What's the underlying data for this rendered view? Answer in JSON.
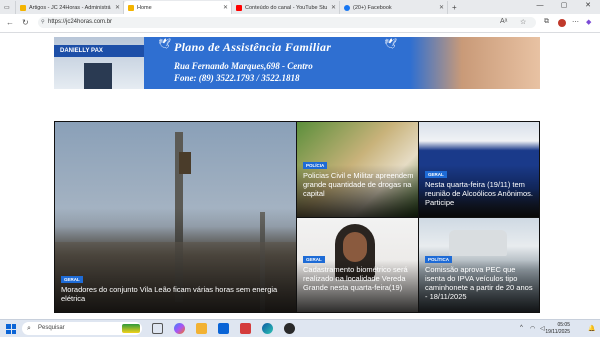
{
  "browser": {
    "tabs": [
      {
        "label": "Artigos - JC 24Horas - Administrá",
        "favicon_color": "#f4b400"
      },
      {
        "label": "Home",
        "favicon_color": "#f4b400",
        "active": true
      },
      {
        "label": "Conteúdo do canal - YouTube Stu",
        "favicon_color": "#ff0000"
      },
      {
        "label": "(20+) Facebook",
        "favicon_color": "#1877f2"
      }
    ],
    "new_tab": "+",
    "url": "https://jc24horas.com.br",
    "window_controls": {
      "minimize": "—",
      "maximize": "▢",
      "close": "✕"
    }
  },
  "banner": {
    "store_sign": "DANIELLY PAX",
    "title": "Plano de Assistência Familiar",
    "address": "Rua Fernando Marques,698 - Centro",
    "phone": "Fone: (89) 3522.1793 / 3522.1818"
  },
  "news": [
    {
      "category": "GERAL",
      "headline": "Moradores do conjunto Vila Leão ficam várias horas sem energia elétrica"
    },
    {
      "category": "POLÍCIA",
      "headline": "Policias Civil e Militar apreendem grande quantidade de drogas na capital"
    },
    {
      "category": "GERAL",
      "headline": "Nesta quarta-feira (19/11) tem reunião de Alcoólicos Anônimos. Participe"
    },
    {
      "category": "GERAL",
      "headline": "Cadastramento biométrico será realizado na localidade Vereda Grande nesta quarta-feira(19)"
    },
    {
      "category": "POLÍTICA",
      "headline": "Comissão aprova PEC que isenta do IPVA veículos tipo caminhonete a partir de 20 anos - 18/11/2025"
    }
  ],
  "taskbar": {
    "search_placeholder": "Pesquisar",
    "time": "05:05",
    "date": "19/11/2025"
  },
  "colors": {
    "badge": "#1e6bd6",
    "banner_bg": "#2f6fd1"
  }
}
